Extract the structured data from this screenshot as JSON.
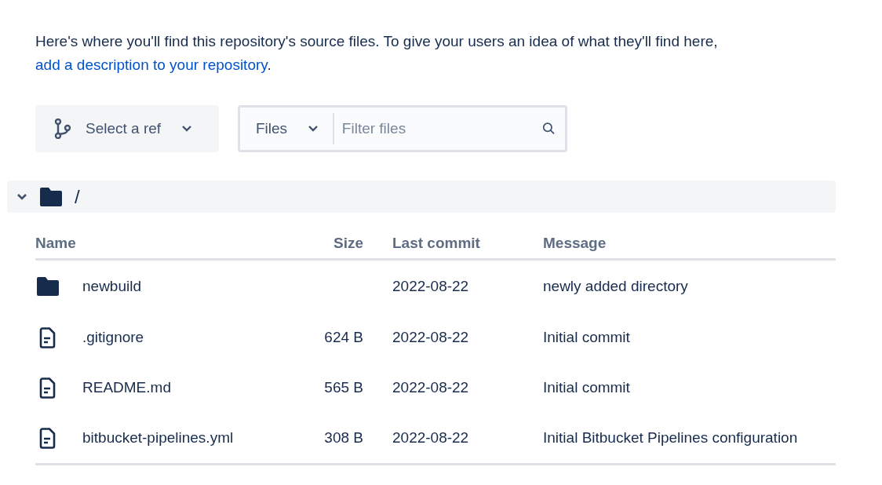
{
  "description": {
    "text": "Here's where you'll find this repository's source files. To give your users an idea of what they'll find here,",
    "link": "add a description to your repository",
    "end": "."
  },
  "toolbar": {
    "ref_select": {
      "label": "Select a ref"
    },
    "filter": {
      "scope": "Files",
      "placeholder": "Filter files"
    }
  },
  "root": {
    "path": "/",
    "expanded": true
  },
  "table": {
    "columns": [
      "Name",
      "Size",
      "Last commit",
      "Message"
    ],
    "rows": [
      {
        "kind": "folder",
        "name": "newbuild",
        "size": "",
        "last_commit": "2022-08-22",
        "message": "newly added directory"
      },
      {
        "kind": "file",
        "name": ".gitignore",
        "size": "624 B",
        "last_commit": "2022-08-22",
        "message": "Initial commit"
      },
      {
        "kind": "file",
        "name": "README.md",
        "size": "565 B",
        "last_commit": "2022-08-22",
        "message": "Initial commit"
      },
      {
        "kind": "file",
        "name": "bitbucket-pipelines.yml",
        "size": "308 B",
        "last_commit": "2022-08-22",
        "message": "Initial Bitbucket Pipelines configuration"
      }
    ]
  }
}
